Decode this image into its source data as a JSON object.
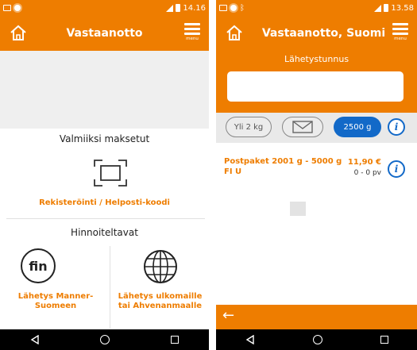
{
  "left_screen": {
    "status_bar": {
      "time": "14.16"
    },
    "app_bar": {
      "title": "Vastaanotto",
      "menu_label": "menu"
    },
    "paid_section": {
      "heading": "Valmiiksi maksetut",
      "register_link": "Rekisteröinti / Helposti-koodi"
    },
    "priced_section": {
      "heading": "Hinnoiteltavat",
      "fin_icon_text": "fin",
      "option_domestic": "Lähetys Manner-Suomeen",
      "option_abroad": "Lähetys ulkomaille tai Ahvenanmaalle"
    }
  },
  "right_screen": {
    "status_bar": {
      "time": "13.58"
    },
    "app_bar": {
      "title": "Vastaanotto, Suomi",
      "menu_label": "menu"
    },
    "tracking": {
      "label": "Lähetystunnus",
      "value": ""
    },
    "filters": {
      "weight_chip": "Yli 2 kg",
      "selected_chip": "2500 g"
    },
    "results": [
      {
        "name": "Postpaket 2001 g - 5000 g FI U",
        "price": "11,90 €",
        "delivery": "0 - 0 pv"
      }
    ]
  },
  "colors": {
    "brand": "#ee7d00",
    "selected": "#1269c8"
  },
  "icons": [
    "home-icon",
    "menu-icon",
    "scan-icon",
    "fin-icon",
    "globe-icon",
    "envelope-icon",
    "info-icon",
    "back-arrow-icon"
  ]
}
